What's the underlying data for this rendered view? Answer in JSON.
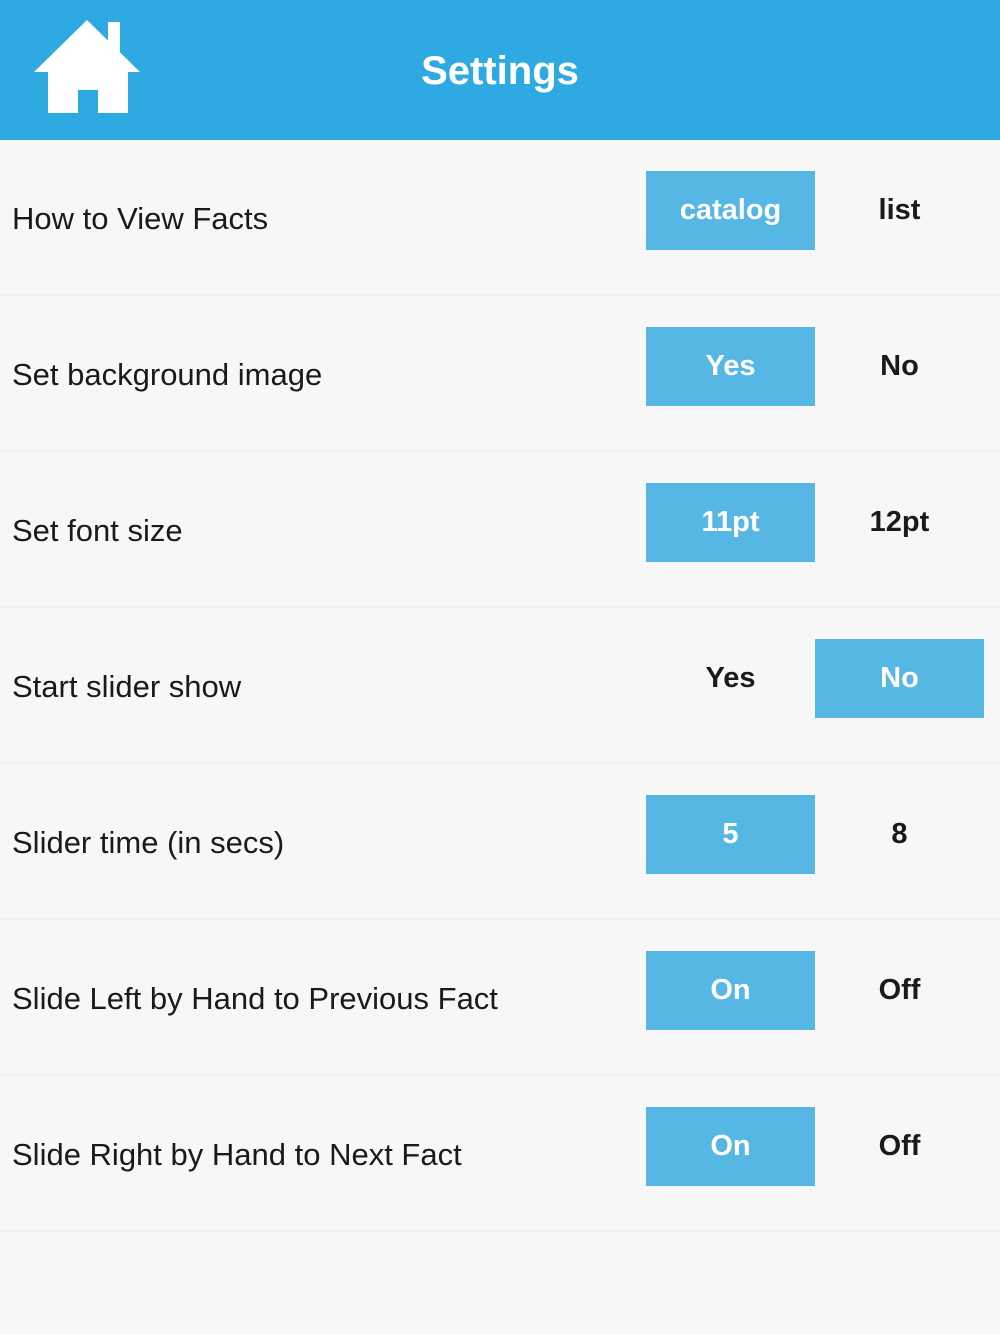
{
  "header": {
    "title": "Settings",
    "home_icon": "home-icon"
  },
  "colors": {
    "header_bg": "#2ea9e1",
    "selected_option_bg": "#57b7e4",
    "page_bg": "#f7f7f7"
  },
  "settings": [
    {
      "label": "How to View Facts",
      "options": [
        "catalog",
        "list"
      ],
      "selected": 0
    },
    {
      "label": "Set background image",
      "options": [
        "Yes",
        "No"
      ],
      "selected": 0
    },
    {
      "label": "Set font size",
      "options": [
        "11pt",
        "12pt"
      ],
      "selected": 0
    },
    {
      "label": "Start slider show",
      "options": [
        "Yes",
        "No"
      ],
      "selected": 1
    },
    {
      "label": "Slider time (in secs)",
      "options": [
        "5",
        "8"
      ],
      "selected": 0
    },
    {
      "label": "Slide Left by Hand to Previous Fact",
      "options": [
        "On",
        "Off"
      ],
      "selected": 0
    },
    {
      "label": "Slide Right by Hand to Next Fact",
      "options": [
        "On",
        "Off"
      ],
      "selected": 0
    }
  ]
}
